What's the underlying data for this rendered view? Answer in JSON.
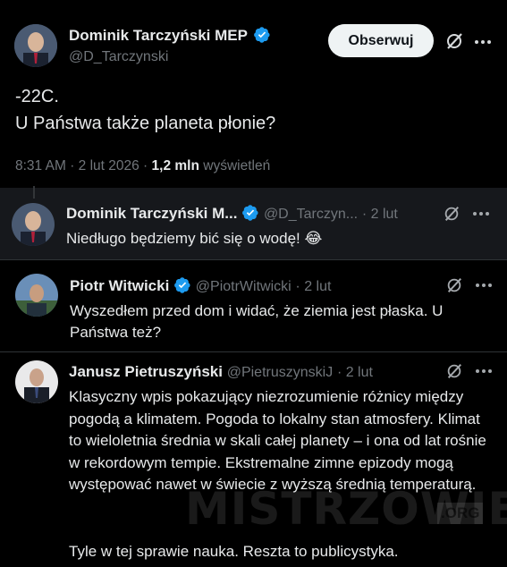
{
  "main_tweet": {
    "author_name": "Dominik Tarczyński MEP",
    "handle": "@D_Tarczynski",
    "follow_label": "Obserwuj",
    "line1": "-22C.",
    "line2": "U Państwa także planeta płonie?",
    "time": "8:31 AM",
    "date": "· 2 lut 2026 ·",
    "views_count": "1,2 mln",
    "views_label": "wyświetleń"
  },
  "replies": [
    {
      "author_name": "Dominik Tarczyński M...",
      "handle": "@D_Tarczyn...",
      "date": "· 2 lut",
      "text": "Niedługo będziemy bić się o wodę! 😂"
    },
    {
      "author_name": "Piotr Witwicki",
      "handle": "@PiotrWitwicki",
      "date": "· 2 lut",
      "text": "Wyszedłem przed dom i widać, że ziemia jest płaska. U Państwa też?"
    },
    {
      "author_name": "Janusz Pietruszyński",
      "handle": "@PietruszynskiJ",
      "date": "· 2 lut",
      "paragraph1": "Klasyczny wpis pokazujący niezrozumienie różnicy między pogodą a klimatem. Pogoda to lokalny stan atmosfery. Klimat to wieloletnia średnia w skali całej planety – i ona od lat rośnie w rekordowym tempie. Ekstremalne zimne epizody mogą występować nawet w świecie z wyższą średnią temperaturą.",
      "paragraph2": "Tyle w tej sprawie nauka. Reszta to publicystyka."
    }
  ],
  "watermark": {
    "text": "MISTRZOWIE",
    "suffix": ".ORG"
  },
  "icons": {
    "verified": "verified-badge-icon",
    "grok": "grok-slash-icon",
    "more": "more-dots-icon"
  },
  "colors": {
    "background": "#000000",
    "verified": "#1d9bf0",
    "text": "#e7e9ea",
    "secondary": "#71767b",
    "button_bg": "#eff3f4"
  }
}
